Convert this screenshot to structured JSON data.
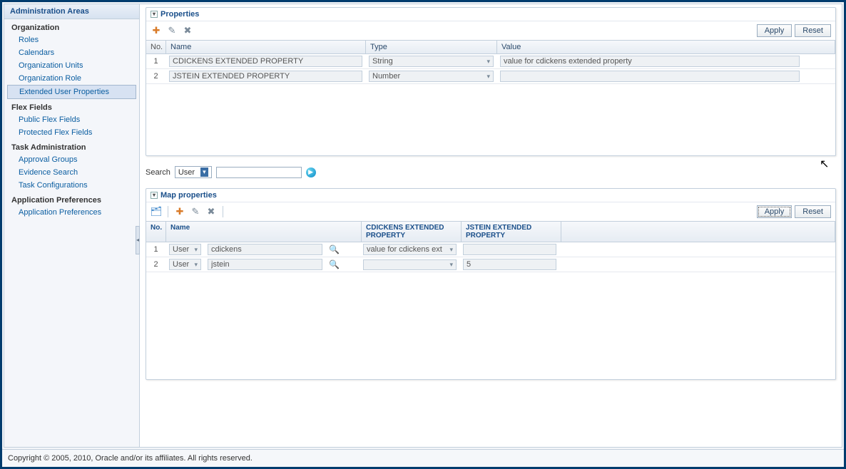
{
  "sidebar": {
    "title": "Administration Areas",
    "sections": [
      {
        "label": "Organization",
        "items": [
          "Roles",
          "Calendars",
          "Organization Units",
          "Organization Role",
          "Extended User Properties"
        ]
      },
      {
        "label": "Flex Fields",
        "items": [
          "Public Flex Fields",
          "Protected Flex Fields"
        ]
      },
      {
        "label": "Task Administration",
        "items": [
          "Approval Groups",
          "Evidence Search",
          "Task Configurations"
        ]
      },
      {
        "label": "Application Preferences",
        "items": [
          "Application Preferences"
        ]
      }
    ],
    "selected": "Extended User Properties"
  },
  "properties": {
    "title": "Properties",
    "buttons": {
      "apply": "Apply",
      "reset": "Reset"
    },
    "columns": {
      "no": "No.",
      "name": "Name",
      "type": "Type",
      "value": "Value"
    },
    "rows": [
      {
        "no": "1",
        "name": "CDICKENS EXTENDED PROPERTY",
        "type": "String",
        "value": "value for cdickens extended property"
      },
      {
        "no": "2",
        "name": "JSTEIN EXTENDED PROPERTY",
        "type": "Number",
        "value": ""
      }
    ]
  },
  "search": {
    "label": "Search",
    "type": "User",
    "value": ""
  },
  "map": {
    "title": "Map properties",
    "buttons": {
      "apply": "Apply",
      "reset": "Reset"
    },
    "columns": {
      "no": "No.",
      "name": "Name",
      "col1a": "CDICKENS EXTENDED",
      "col1b": "PROPERTY",
      "col2a": "JSTEIN EXTENDED",
      "col2b": "PROPERTY"
    },
    "rows": [
      {
        "no": "1",
        "userType": "User",
        "userName": "cdickens",
        "cdickens": "value for cdickens ext",
        "jstein": ""
      },
      {
        "no": "2",
        "userType": "User",
        "userName": "jstein",
        "cdickens": "",
        "jstein": "5"
      }
    ]
  },
  "footer": "Copyright © 2005, 2010, Oracle and/or its affiliates. All rights reserved."
}
